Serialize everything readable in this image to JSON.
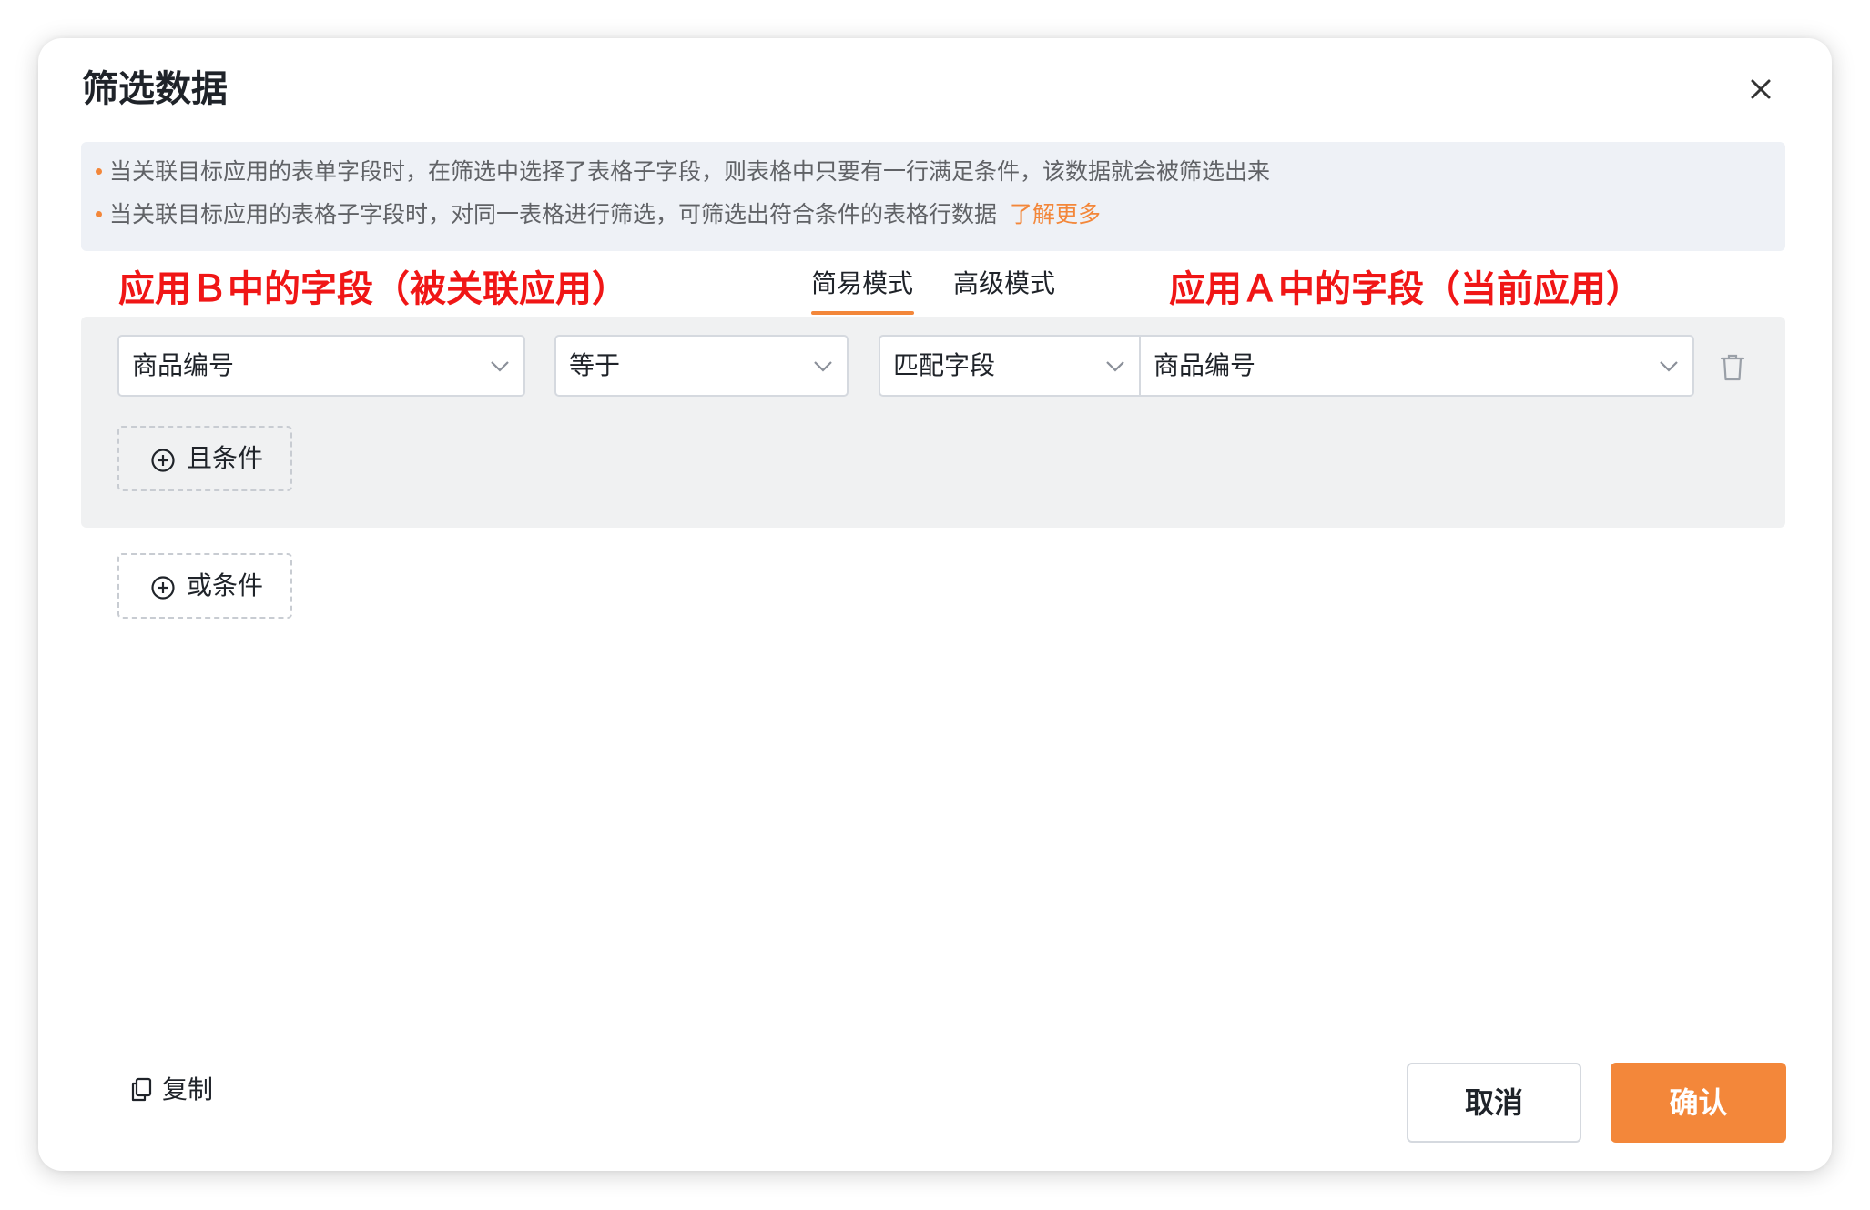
{
  "dialog": {
    "title": "筛选数据",
    "close_icon": "close-icon"
  },
  "notice": {
    "lines": [
      "当关联目标应用的表单字段时，在筛选中选择了表格子字段，则表格中只要有一行满足条件，该数据就会被筛选出来",
      "当关联目标应用的表格子字段时，对同一表格进行筛选，可筛选出符合条件的表格行数据"
    ],
    "link": "了解更多",
    "link_color": "#f3873a"
  },
  "annotations": {
    "left": "应用Ｂ中的字段（被关联应用）",
    "right": "应用Ａ中的字段（当前应用）",
    "color": "#f01616"
  },
  "tabs": [
    {
      "label": "简易模式",
      "active": true
    },
    {
      "label": "高级模式",
      "active": false
    }
  ],
  "condition": {
    "field": "商品编号",
    "operator": "等于",
    "value_type": "匹配字段",
    "target_field": "商品编号",
    "delete_icon": "trash-icon"
  },
  "buttons": {
    "and_condition": "且条件",
    "or_condition": "或条件",
    "copy": "复制",
    "cancel": "取消",
    "confirm": "确认"
  },
  "colors": {
    "accent": "#f3873a",
    "notice_bg": "#eef1f6",
    "group_bg": "#f0f1f2"
  }
}
